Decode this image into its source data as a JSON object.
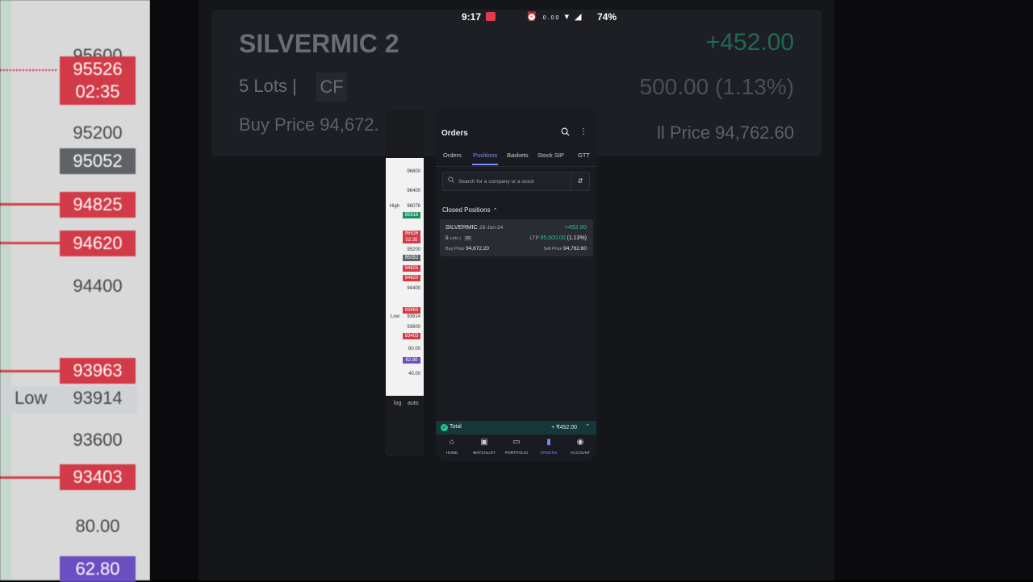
{
  "status_bar": {
    "time": "9:17",
    "net_speed": "0.00",
    "battery": "74%"
  },
  "background_left": {
    "tags": [
      {
        "text": "95526",
        "color": "#d23a47"
      },
      {
        "text": "02:35",
        "color": "#d23a47"
      },
      {
        "text": "95052",
        "color": "#5f6368"
      },
      {
        "text": "94825",
        "color": "#d23a47"
      },
      {
        "text": "94620",
        "color": "#d23a47"
      },
      {
        "text": "93963",
        "color": "#d23a47"
      },
      {
        "text": "93403",
        "color": "#d23a47"
      },
      {
        "text": "62.80",
        "color": "#6b4fc0"
      }
    ],
    "plain": [
      "95600",
      "95200",
      "94400",
      "93914",
      "93600",
      "80.00"
    ],
    "low_label": "Low"
  },
  "background_card": {
    "symbol": "SILVERMIC 2",
    "lots": "5  Lots |",
    "cf": "CF",
    "buy": "Buy Price 94,672.",
    "pnl": "+452.00",
    "ltp": "500.00 (1.13%)",
    "sell": "ll Price 94,762.60"
  },
  "ghost_chart": {
    "labels": [
      "96800",
      "96400",
      "High",
      "96076",
      "95200",
      "94400",
      "93600",
      "80.00",
      "40.00",
      "Low",
      "93914",
      "log",
      "auto"
    ],
    "tags": [
      {
        "text": "95918",
        "color": "#1b8f66"
      },
      {
        "text": "95526",
        "color": "#d23a47"
      },
      {
        "text": "02:35",
        "color": "#d23a47"
      },
      {
        "text": "95052",
        "color": "#5f6368"
      },
      {
        "text": "94825",
        "color": "#d23a47"
      },
      {
        "text": "94620",
        "color": "#d23a47"
      },
      {
        "text": "93963",
        "color": "#d23a47"
      },
      {
        "text": "93403",
        "color": "#d23a47"
      },
      {
        "text": "62.80",
        "color": "#6b4fc0"
      }
    ]
  },
  "header": {
    "title": "Orders"
  },
  "tabs": [
    "Orders",
    "Positions",
    "Baskets",
    "Stock SIP",
    "GTT"
  ],
  "active_tab": "Positions",
  "search": {
    "placeholder": "Search for a company or a stock"
  },
  "section": {
    "title": "Closed Positions"
  },
  "position": {
    "symbol": "SILVERMIC",
    "expiry": "28-Jun-24",
    "pnl": "+452.00",
    "lots": "5",
    "lots_label": "Lots |",
    "cf": "CF",
    "ltp_label": "LTP",
    "ltp": "95,500.00",
    "change_pct": "(1.13%)",
    "buy_label": "Buy Price",
    "buy_price": "94,672.20",
    "sell_label": "Sell Price",
    "sell_price": "94,762.60"
  },
  "total": {
    "label": "Total",
    "amount": "+ ₹452.00"
  },
  "nav": [
    {
      "label": "HOME",
      "icon": "home-icon"
    },
    {
      "label": "WATCHLIST",
      "icon": "watchlist-icon"
    },
    {
      "label": "PORTFOLIO",
      "icon": "portfolio-icon"
    },
    {
      "label": "ORDERS",
      "icon": "orders-icon"
    },
    {
      "label": "ACCOUNT",
      "icon": "account-icon"
    }
  ],
  "colors": {
    "accent": "#7b8cff",
    "profit": "#22c38e",
    "loss": "#d23a47"
  }
}
